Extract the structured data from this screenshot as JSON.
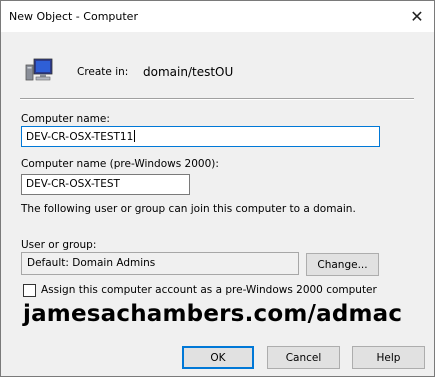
{
  "window": {
    "title": "New Object - Computer",
    "close_glyph": "✕"
  },
  "create_in": {
    "label": "Create in:",
    "value": "domain/testOU",
    "icon": "computer-icon"
  },
  "computer_name": {
    "label": "Computer name:",
    "value": "DEV-CR-OSX-TEST11"
  },
  "pre2000_name": {
    "label": "Computer name (pre-Windows 2000):",
    "value": "DEV-CR-OSX-TEST"
  },
  "join_info": "The following user or group can join this computer to a domain.",
  "user_group": {
    "label": "User or group:",
    "value": "Default: Domain Admins",
    "change_label": "Change..."
  },
  "assign_checkbox": {
    "label": "Assign this computer account as a pre-Windows 2000 computer",
    "checked": false
  },
  "watermark": "jamesachambers.com/admac",
  "buttons": {
    "ok": "OK",
    "cancel": "Cancel",
    "help": "Help"
  },
  "colors": {
    "focus": "#0078d7",
    "dialog_bg": "#f0f0f0"
  }
}
